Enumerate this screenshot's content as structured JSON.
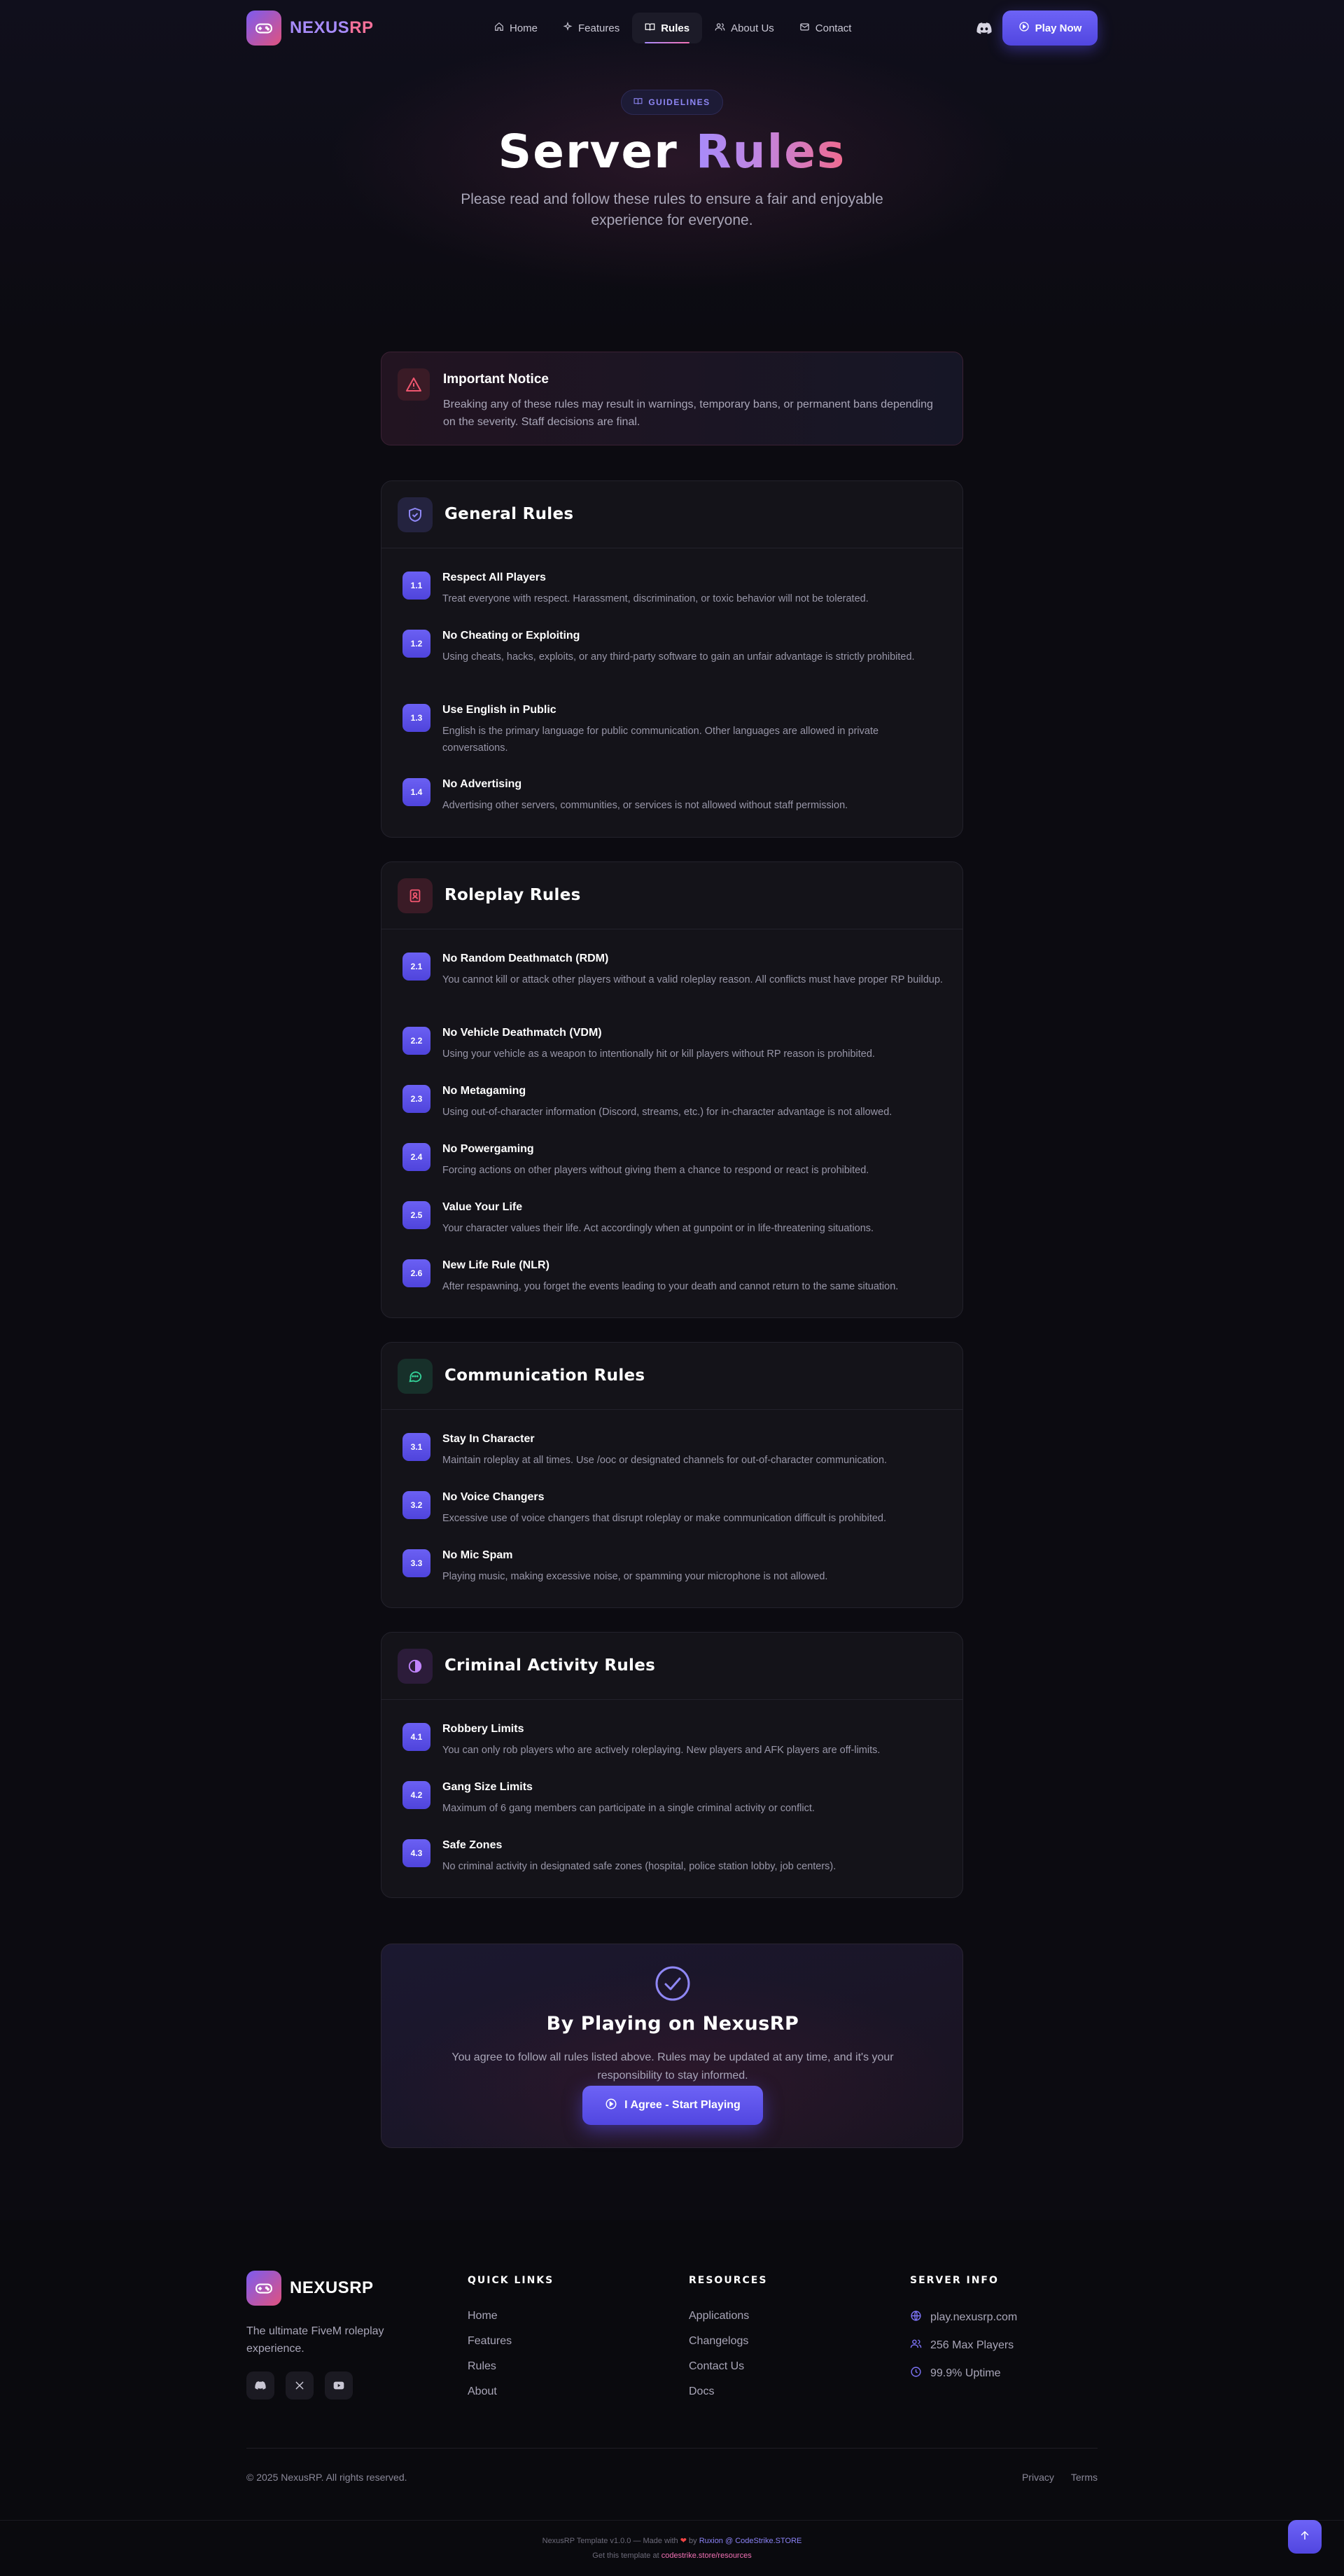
{
  "brand": {
    "name_part1": "NEXUS",
    "name_part2": "RP"
  },
  "nav": {
    "items": [
      {
        "label": "Home",
        "icon": "home-icon"
      },
      {
        "label": "Features",
        "icon": "sparkle-icon"
      },
      {
        "label": "Rules",
        "icon": "book-icon",
        "active": true
      },
      {
        "label": "About Us",
        "icon": "users-icon"
      },
      {
        "label": "Contact",
        "icon": "mail-icon"
      }
    ],
    "discord_icon": "discord-icon",
    "play_label": "Play Now"
  },
  "hero": {
    "badge": "GUIDELINES",
    "title_plain": "Server",
    "title_accent": "Rules",
    "subtitle": "Please read and follow these rules to ensure a fair and enjoyable experience for everyone."
  },
  "notice": {
    "title": "Important Notice",
    "text": "Breaking any of these rules may result in warnings, temporary bans, or permanent bans depending on the severity. Staff decisions are final."
  },
  "sections": [
    {
      "title": "General Rules",
      "icon": "shield-icon",
      "rules": [
        {
          "num": "1.1",
          "title": "Respect All Players",
          "desc": "Treat everyone with respect. Harassment, discrimination, or toxic behavior will not be tolerated."
        },
        {
          "num": "1.2",
          "title": "No Cheating or Exploiting",
          "desc": "Using cheats, hacks, exploits, or any third-party software to gain an unfair advantage is strictly prohibited."
        },
        {
          "num": "1.3",
          "title": "Use English in Public",
          "desc": "English is the primary language for public communication. Other languages are allowed in private conversations."
        },
        {
          "num": "1.4",
          "title": "No Advertising",
          "desc": "Advertising other servers, communities, or services is not allowed without staff permission."
        }
      ]
    },
    {
      "title": "Roleplay Rules",
      "icon": "id-card-icon",
      "rules": [
        {
          "num": "2.1",
          "title": "No Random Deathmatch (RDM)",
          "desc": "You cannot kill or attack other players without a valid roleplay reason. All conflicts must have proper RP buildup."
        },
        {
          "num": "2.2",
          "title": "No Vehicle Deathmatch (VDM)",
          "desc": "Using your vehicle as a weapon to intentionally hit or kill players without RP reason is prohibited."
        },
        {
          "num": "2.3",
          "title": "No Metagaming",
          "desc": "Using out-of-character information (Discord, streams, etc.) for in-character advantage is not allowed."
        },
        {
          "num": "2.4",
          "title": "No Powergaming",
          "desc": "Forcing actions on other players without giving them a chance to respond or react is prohibited."
        },
        {
          "num": "2.5",
          "title": "Value Your Life",
          "desc": "Your character values their life. Act accordingly when at gunpoint or in life-threatening situations."
        },
        {
          "num": "2.6",
          "title": "New Life Rule (NLR)",
          "desc": "After respawning, you forget the events leading to your death and cannot return to the same situation."
        }
      ]
    },
    {
      "title": "Communication Rules",
      "icon": "chat-icon",
      "rules": [
        {
          "num": "3.1",
          "title": "Stay In Character",
          "desc": "Maintain roleplay at all times. Use /ooc or designated channels for out-of-character communication."
        },
        {
          "num": "3.2",
          "title": "No Voice Changers",
          "desc": "Excessive use of voice changers that disrupt roleplay or make communication difficult is prohibited."
        },
        {
          "num": "3.3",
          "title": "No Mic Spam",
          "desc": "Playing music, making excessive noise, or spamming your microphone is not allowed."
        }
      ]
    },
    {
      "title": "Criminal Activity Rules",
      "icon": "mask-icon",
      "rules": [
        {
          "num": "4.1",
          "title": "Robbery Limits",
          "desc": "You can only rob players who are actively roleplaying. New players and AFK players are off-limits."
        },
        {
          "num": "4.2",
          "title": "Gang Size Limits",
          "desc": "Maximum of 6 gang members can participate in a single criminal activity or conflict."
        },
        {
          "num": "4.3",
          "title": "Safe Zones",
          "desc": "No criminal activity in designated safe zones (hospital, police station lobby, job centers)."
        }
      ]
    }
  ],
  "agree": {
    "title": "By Playing on NexusRP",
    "text": "You agree to follow all rules listed above. Rules may be updated at any time, and it's your responsibility to stay informed.",
    "button": "I Agree - Start Playing"
  },
  "footer": {
    "brand": "NEXUSRP",
    "tagline": "The ultimate FiveM roleplay experience.",
    "socials": [
      "discord-icon",
      "x-icon",
      "youtube-icon"
    ],
    "quick_links": {
      "title": "QUICK LINKS",
      "items": [
        "Home",
        "Features",
        "Rules",
        "About"
      ]
    },
    "resources": {
      "title": "RESOURCES",
      "items": [
        "Applications",
        "Changelogs",
        "Contact Us",
        "Docs"
      ]
    },
    "server_info": {
      "title": "SERVER INFO",
      "items": [
        {
          "icon": "globe-icon",
          "text": "play.nexusrp.com"
        },
        {
          "icon": "users-icon",
          "text": "256 Max Players"
        },
        {
          "icon": "clock-icon",
          "text": "99.9% Uptime"
        }
      ]
    },
    "copyright": "© 2025 NexusRP. All rights reserved.",
    "legal": [
      "Privacy",
      "Terms"
    ],
    "credit_prefix": "NexusRP Template v1.0.0 — Made with",
    "credit_by": "by",
    "credit_author": "Ruxion @ CodeStrike.STORE",
    "get_prefix": "Get this template at",
    "get_link": "codestrike.store/resources"
  },
  "colors": {
    "accent": "#5b50ea",
    "accent_purple": "#a78bfa",
    "accent_pink": "#f472b6",
    "background": "#0c0b11"
  }
}
